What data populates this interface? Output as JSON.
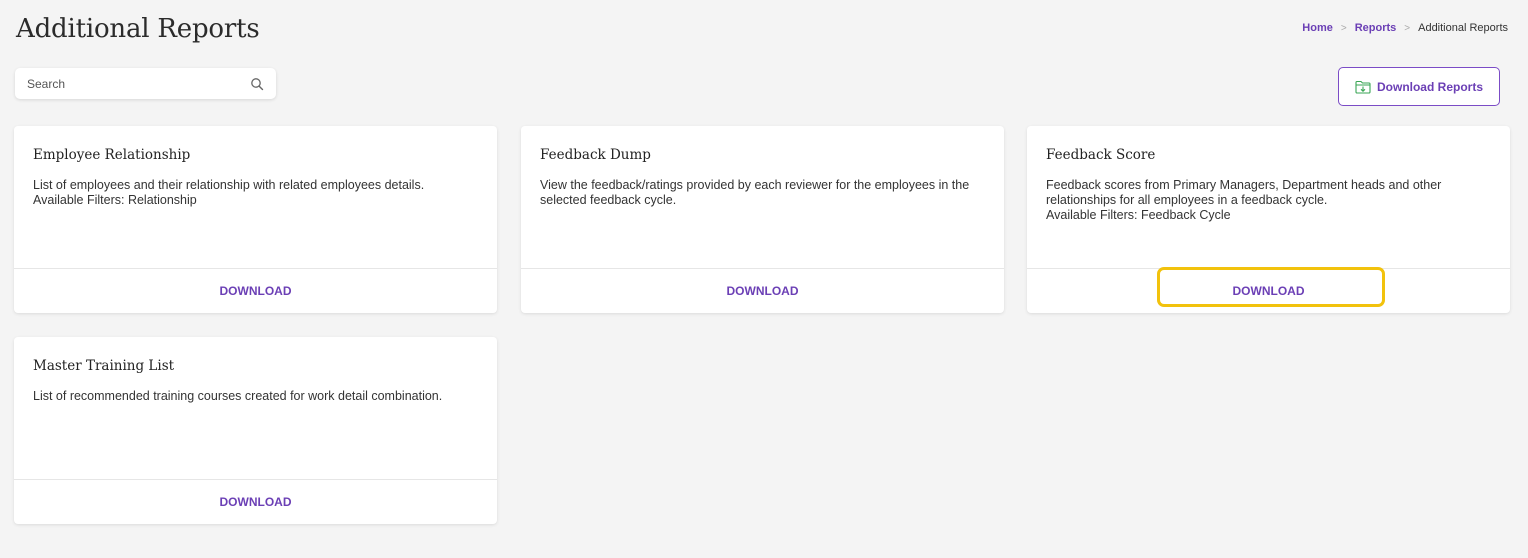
{
  "page": {
    "title": "Additional Reports"
  },
  "breadcrumb": {
    "home": "Home",
    "reports": "Reports",
    "current": "Additional Reports",
    "separator": ">"
  },
  "search": {
    "placeholder": "Search",
    "value": ""
  },
  "toolbar": {
    "download_reports_label": "Download Reports"
  },
  "cards": [
    {
      "title": "Employee Relationship",
      "description": "List of employees and their relationship with related employees details.",
      "filters": "Available Filters: Relationship",
      "action": "DOWNLOAD"
    },
    {
      "title": "Feedback Dump",
      "description": "View the feedback/ratings provided by each reviewer for the employees in the selected feedback cycle.",
      "filters": "",
      "action": "DOWNLOAD"
    },
    {
      "title": "Feedback Score",
      "description": "Feedback scores from Primary Managers, Department heads and other relationships for all employees in a feedback cycle.",
      "filters": "Available Filters: Feedback Cycle",
      "action": "DOWNLOAD",
      "highlighted": true
    },
    {
      "title": "Master Training List",
      "description": "List of recommended training courses created for work detail combination.",
      "filters": "",
      "action": "DOWNLOAD"
    }
  ],
  "colors": {
    "accent": "#6b3fb5",
    "highlight": "#f2c20c",
    "background": "#f4f4f4"
  },
  "icons": {
    "search": "search-icon",
    "download_reports": "folder-download-icon"
  }
}
